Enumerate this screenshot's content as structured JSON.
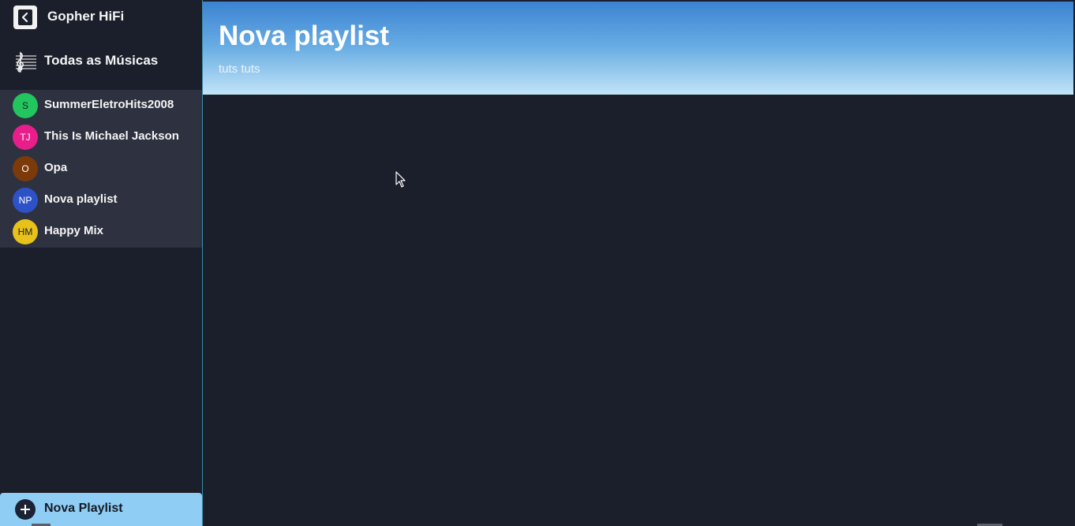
{
  "app": {
    "title": "Gopher HiFi",
    "all_songs_label": "Todas as Músicas"
  },
  "sidebar": {
    "playlists": [
      {
        "initials": "S",
        "name": "SummerEletroHits2008",
        "color": "#22c55e",
        "text_color": "#1b1f2b"
      },
      {
        "initials": "TJ",
        "name": "This Is Michael Jackson",
        "color": "#e91e8c",
        "text_color": "#ffffff"
      },
      {
        "initials": "O",
        "name": "Opa",
        "color": "#7c3a0a",
        "text_color": "#ffffff"
      },
      {
        "initials": "NP",
        "name": "Nova playlist",
        "color": "#2d52c8",
        "text_color": "#ffffff"
      },
      {
        "initials": "HM",
        "name": "Happy Mix",
        "color": "#e6c21a",
        "text_color": "#1b1f2b"
      }
    ],
    "new_playlist_label": "Nova Playlist"
  },
  "header": {
    "title": "Nova playlist",
    "description": "tuts tuts"
  },
  "colors": {
    "background": "#1b1f2b",
    "sidebar_list_bg": "#2e3240",
    "accent_button": "#8fcdf4",
    "header_gradient_top": "#3b83d2",
    "header_gradient_bottom": "#c2e4f8"
  },
  "icons": {
    "brand": "back-arrow-icon",
    "all_songs": "music-staff-icon",
    "new_playlist": "plus-icon",
    "cursor": "mouse-pointer-icon"
  }
}
